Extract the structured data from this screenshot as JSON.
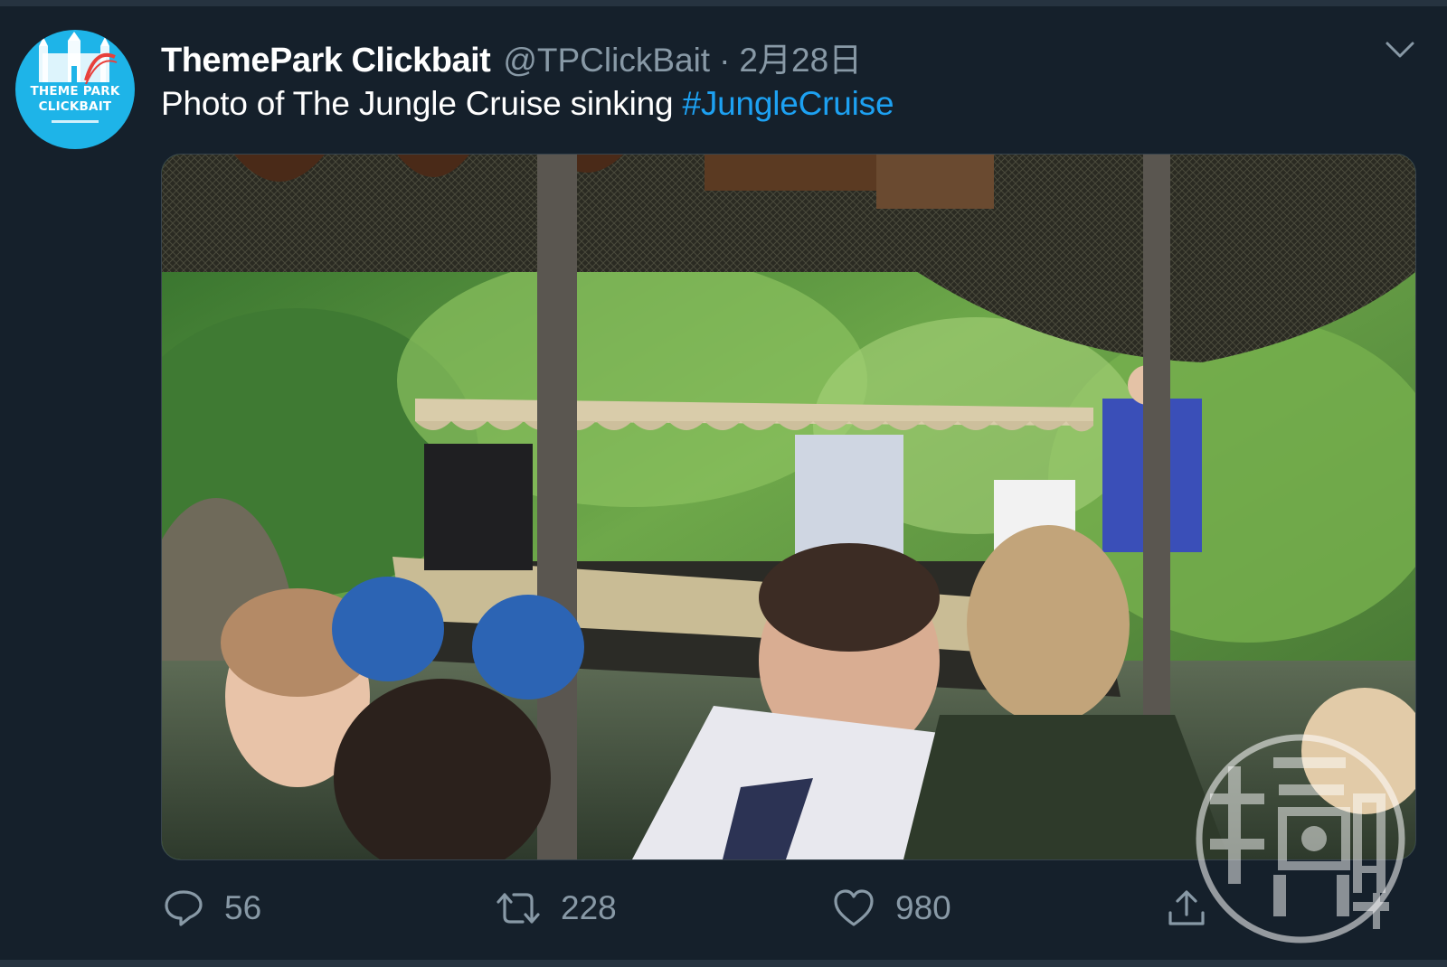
{
  "author": {
    "display_name": "ThemePark Clickbait",
    "handle": "@TPClickBait",
    "separator": "·",
    "date": "2月28日",
    "avatar_line1": "THEME PARK",
    "avatar_line2": "CLICKBAIT"
  },
  "tweet": {
    "text": "Photo of The Jungle Cruise sinking ",
    "hashtag": "#JungleCruise"
  },
  "actions": {
    "reply_count": "56",
    "retweet_count": "228",
    "like_count": "980"
  },
  "watermark": {
    "text": "鏡週刊"
  },
  "colors": {
    "background": "#15202b",
    "text_primary": "#ffffff",
    "text_secondary": "#8899a6",
    "accent": "#1da1f2",
    "avatar_bg": "#1eb4e8"
  },
  "icons": [
    "chevron-down-icon",
    "reply-icon",
    "retweet-icon",
    "like-icon",
    "share-icon"
  ]
}
